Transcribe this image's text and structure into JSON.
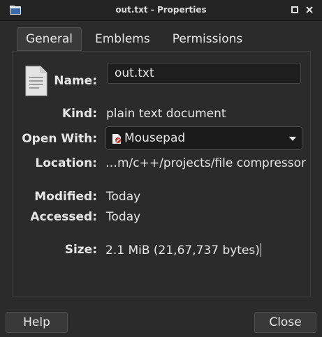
{
  "window": {
    "title": "out.txt - Properties"
  },
  "tabs": [
    {
      "label": "General",
      "active": true
    },
    {
      "label": "Emblems",
      "active": false
    },
    {
      "label": "Permissions",
      "active": false
    }
  ],
  "general": {
    "name_label": "Name:",
    "name_value": "out.txt",
    "kind_label": "Kind:",
    "kind_value": "plain text document",
    "open_with_label": "Open With:",
    "open_with_value": "Mousepad",
    "location_label": "Location:",
    "location_value": "…m/c++/projects/file compressor",
    "modified_label": "Modified:",
    "modified_value": "Today",
    "accessed_label": "Accessed:",
    "accessed_value": "Today",
    "size_label": "Size:",
    "size_value": "2.1 MiB (21,67,737 bytes)"
  },
  "buttons": {
    "help": "Help",
    "close": "Close"
  },
  "icons": {
    "window": "folder-icon",
    "file": "text-file-icon",
    "app": "mousepad-icon",
    "dropdown": "chevron-down-icon"
  }
}
